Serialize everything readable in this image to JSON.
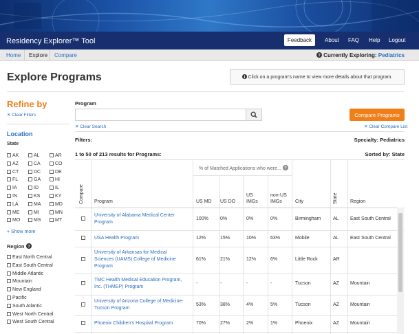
{
  "header": {
    "brand": "Residency Explorer™ Tool",
    "feedback": "Feedback",
    "links": [
      "About",
      "FAQ",
      "Help",
      "Logout"
    ]
  },
  "subnav": {
    "tabs": [
      "Home",
      "Explore",
      "Compare"
    ],
    "exploring_label": "Currently Exploring:",
    "exploring_value": "Pediatrics"
  },
  "page": {
    "title": "Explore Programs",
    "info": "Click on a program's name to view more details about that program."
  },
  "sidebar": {
    "refine": "Refine by",
    "clear_filters": "Clear Filters",
    "location": "Location",
    "state_label": "State",
    "states": [
      "AK",
      "AL",
      "AR",
      "AZ",
      "CA",
      "CO",
      "CT",
      "DC",
      "DE",
      "FL",
      "GA",
      "HI",
      "IA",
      "ID",
      "IL",
      "IN",
      "KS",
      "KY",
      "LA",
      "MA",
      "MD",
      "ME",
      "MI",
      "MN",
      "MO",
      "MS",
      "MT"
    ],
    "show_more": "Show more",
    "region_label": "Region",
    "regions": [
      "East North Central",
      "East South Central",
      "Middle Atlantic",
      "Mountain",
      "New England",
      "Pacific",
      "South Atlantic",
      "West North Central",
      "West South Central"
    ]
  },
  "search": {
    "label": "Program",
    "placeholder": "",
    "clear_search": "Clear Search",
    "compare_button": "Compare Programs",
    "clear_compare": "Clear Compare List"
  },
  "filters": {
    "label": "Filters:",
    "specialty": "Specialty: Pediatrics",
    "results": "1 to 50 of 213 results for Programs:",
    "sorted": "Sorted by: State"
  },
  "table": {
    "group_header": "% of Matched Applications who were...",
    "headers": {
      "compare": "Compare",
      "program": "Program",
      "us_md": "US MD",
      "us_do": "US DO",
      "us_imgs_1": "US",
      "us_imgs_2": "IMGs",
      "non_us_1": "non-US",
      "non_us_2": "IMGs",
      "city": "City",
      "state": "State",
      "region": "Region"
    },
    "rows": [
      {
        "program": [
          "University of Alabama Medical Center",
          "Program"
        ],
        "us_md": "100%",
        "us_do": "0%",
        "us_img": "0%",
        "non_us": "0%",
        "city": "Birmingham",
        "state": "AL",
        "region": "East South Central"
      },
      {
        "program": [
          "USA Health Program"
        ],
        "us_md": "12%",
        "us_do": "15%",
        "us_img": "10%",
        "non_us": "63%",
        "city": "Mobile",
        "state": "AL",
        "region": "East South Central"
      },
      {
        "program": [
          "University of Arkansas for Medical",
          "Sciences (UAMS) College of Medicine",
          "Program"
        ],
        "us_md": "61%",
        "us_do": "21%",
        "us_img": "12%",
        "non_us": "6%",
        "city": "Little Rock",
        "state": "AR",
        "region": ""
      },
      {
        "program": [
          "TMC Health Medical Education Program,",
          "Inc. (THMEP) Program"
        ],
        "us_md": "-",
        "us_do": "-",
        "us_img": "-",
        "non_us": "-",
        "city": "Tucson",
        "state": "AZ",
        "region": "Mountain"
      },
      {
        "program": [
          "University of Arizona College of Medicine-",
          "Tucson Program"
        ],
        "us_md": "53%",
        "us_do": "38%",
        "us_img": "4%",
        "non_us": "5%",
        "city": "Tucson",
        "state": "AZ",
        "region": "Mountain"
      },
      {
        "program": [
          "Phoenix Children's Hospital Program"
        ],
        "us_md": "70%",
        "us_do": "27%",
        "us_img": "2%",
        "non_us": "1%",
        "city": "Phoenix",
        "state": "AZ",
        "region": "Mountain"
      }
    ]
  }
}
